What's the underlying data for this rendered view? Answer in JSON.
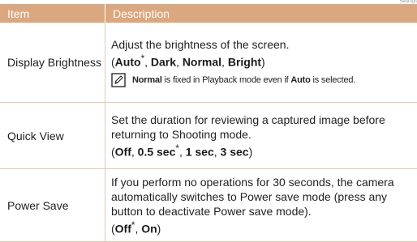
{
  "page_mark": "Settings",
  "header": {
    "item": "Item",
    "description": "Description"
  },
  "rows": [
    {
      "item": "Display Brightness",
      "desc_text": "Adjust the brightness of the screen.",
      "options": [
        "Auto",
        "Dark",
        "Normal",
        "Bright"
      ],
      "note": {
        "icon": "note-pencil-icon",
        "bold1": "Normal",
        "text1": " is fixed in Playback mode even if ",
        "bold2": "Auto",
        "text2": " is selected."
      }
    },
    {
      "item": "Quick View",
      "desc_text": "Set the duration for reviewing a captured image before returning to Shooting mode.",
      "options": [
        "Off",
        "0.5 sec",
        "1 sec",
        "3 sec"
      ]
    },
    {
      "item": "Power Save",
      "desc_text": "If you perform no operations for 30 seconds, the camera automatically switches to Power save mode (press any button to deactivate Power save mode).",
      "options": [
        "Off",
        "On"
      ]
    }
  ],
  "punct": {
    "open": "(",
    "close": ")",
    "sep": ", ",
    "default_mark": "*"
  }
}
